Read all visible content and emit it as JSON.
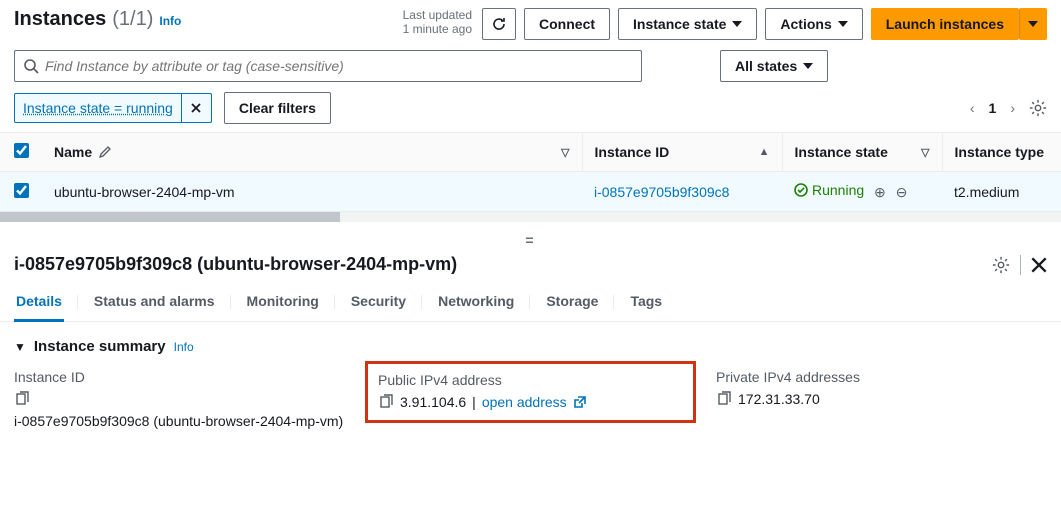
{
  "header": {
    "title": "Instances",
    "count": "(1/1)",
    "info": "Info",
    "last_updated_l1": "Last updated",
    "last_updated_l2": "1 minute ago",
    "connect": "Connect",
    "state_menu": "Instance state",
    "actions": "Actions",
    "launch": "Launch instances"
  },
  "search": {
    "placeholder": "Find Instance by attribute or tag (case-sensitive)",
    "all_states": "All states"
  },
  "chips": {
    "filter_text": "Instance state = running",
    "clear": "Clear filters"
  },
  "pager": {
    "page": "1"
  },
  "table": {
    "cols": {
      "name": "Name",
      "id": "Instance ID",
      "state": "Instance state",
      "type": "Instance type"
    },
    "rows": [
      {
        "name": "ubuntu-browser-2404-mp-vm",
        "id": "i-0857e9705b9f309c8",
        "state": "Running",
        "type": "t2.medium"
      }
    ]
  },
  "detail": {
    "title": "i-0857e9705b9f309c8 (ubuntu-browser-2404-mp-vm)",
    "tabs": [
      "Details",
      "Status and alarms",
      "Monitoring",
      "Security",
      "Networking",
      "Storage",
      "Tags"
    ],
    "summary_head": "Instance summary",
    "info": "Info",
    "instance_id_label": "Instance ID",
    "instance_id_value": "i-0857e9705b9f309c8 (ubuntu-browser-2404-mp-vm)",
    "pub_ip_label": "Public IPv4 address",
    "pub_ip_value": "3.91.104.6",
    "open_addr": "open address",
    "priv_ip_label": "Private IPv4 addresses",
    "priv_ip_value": "172.31.33.70"
  }
}
